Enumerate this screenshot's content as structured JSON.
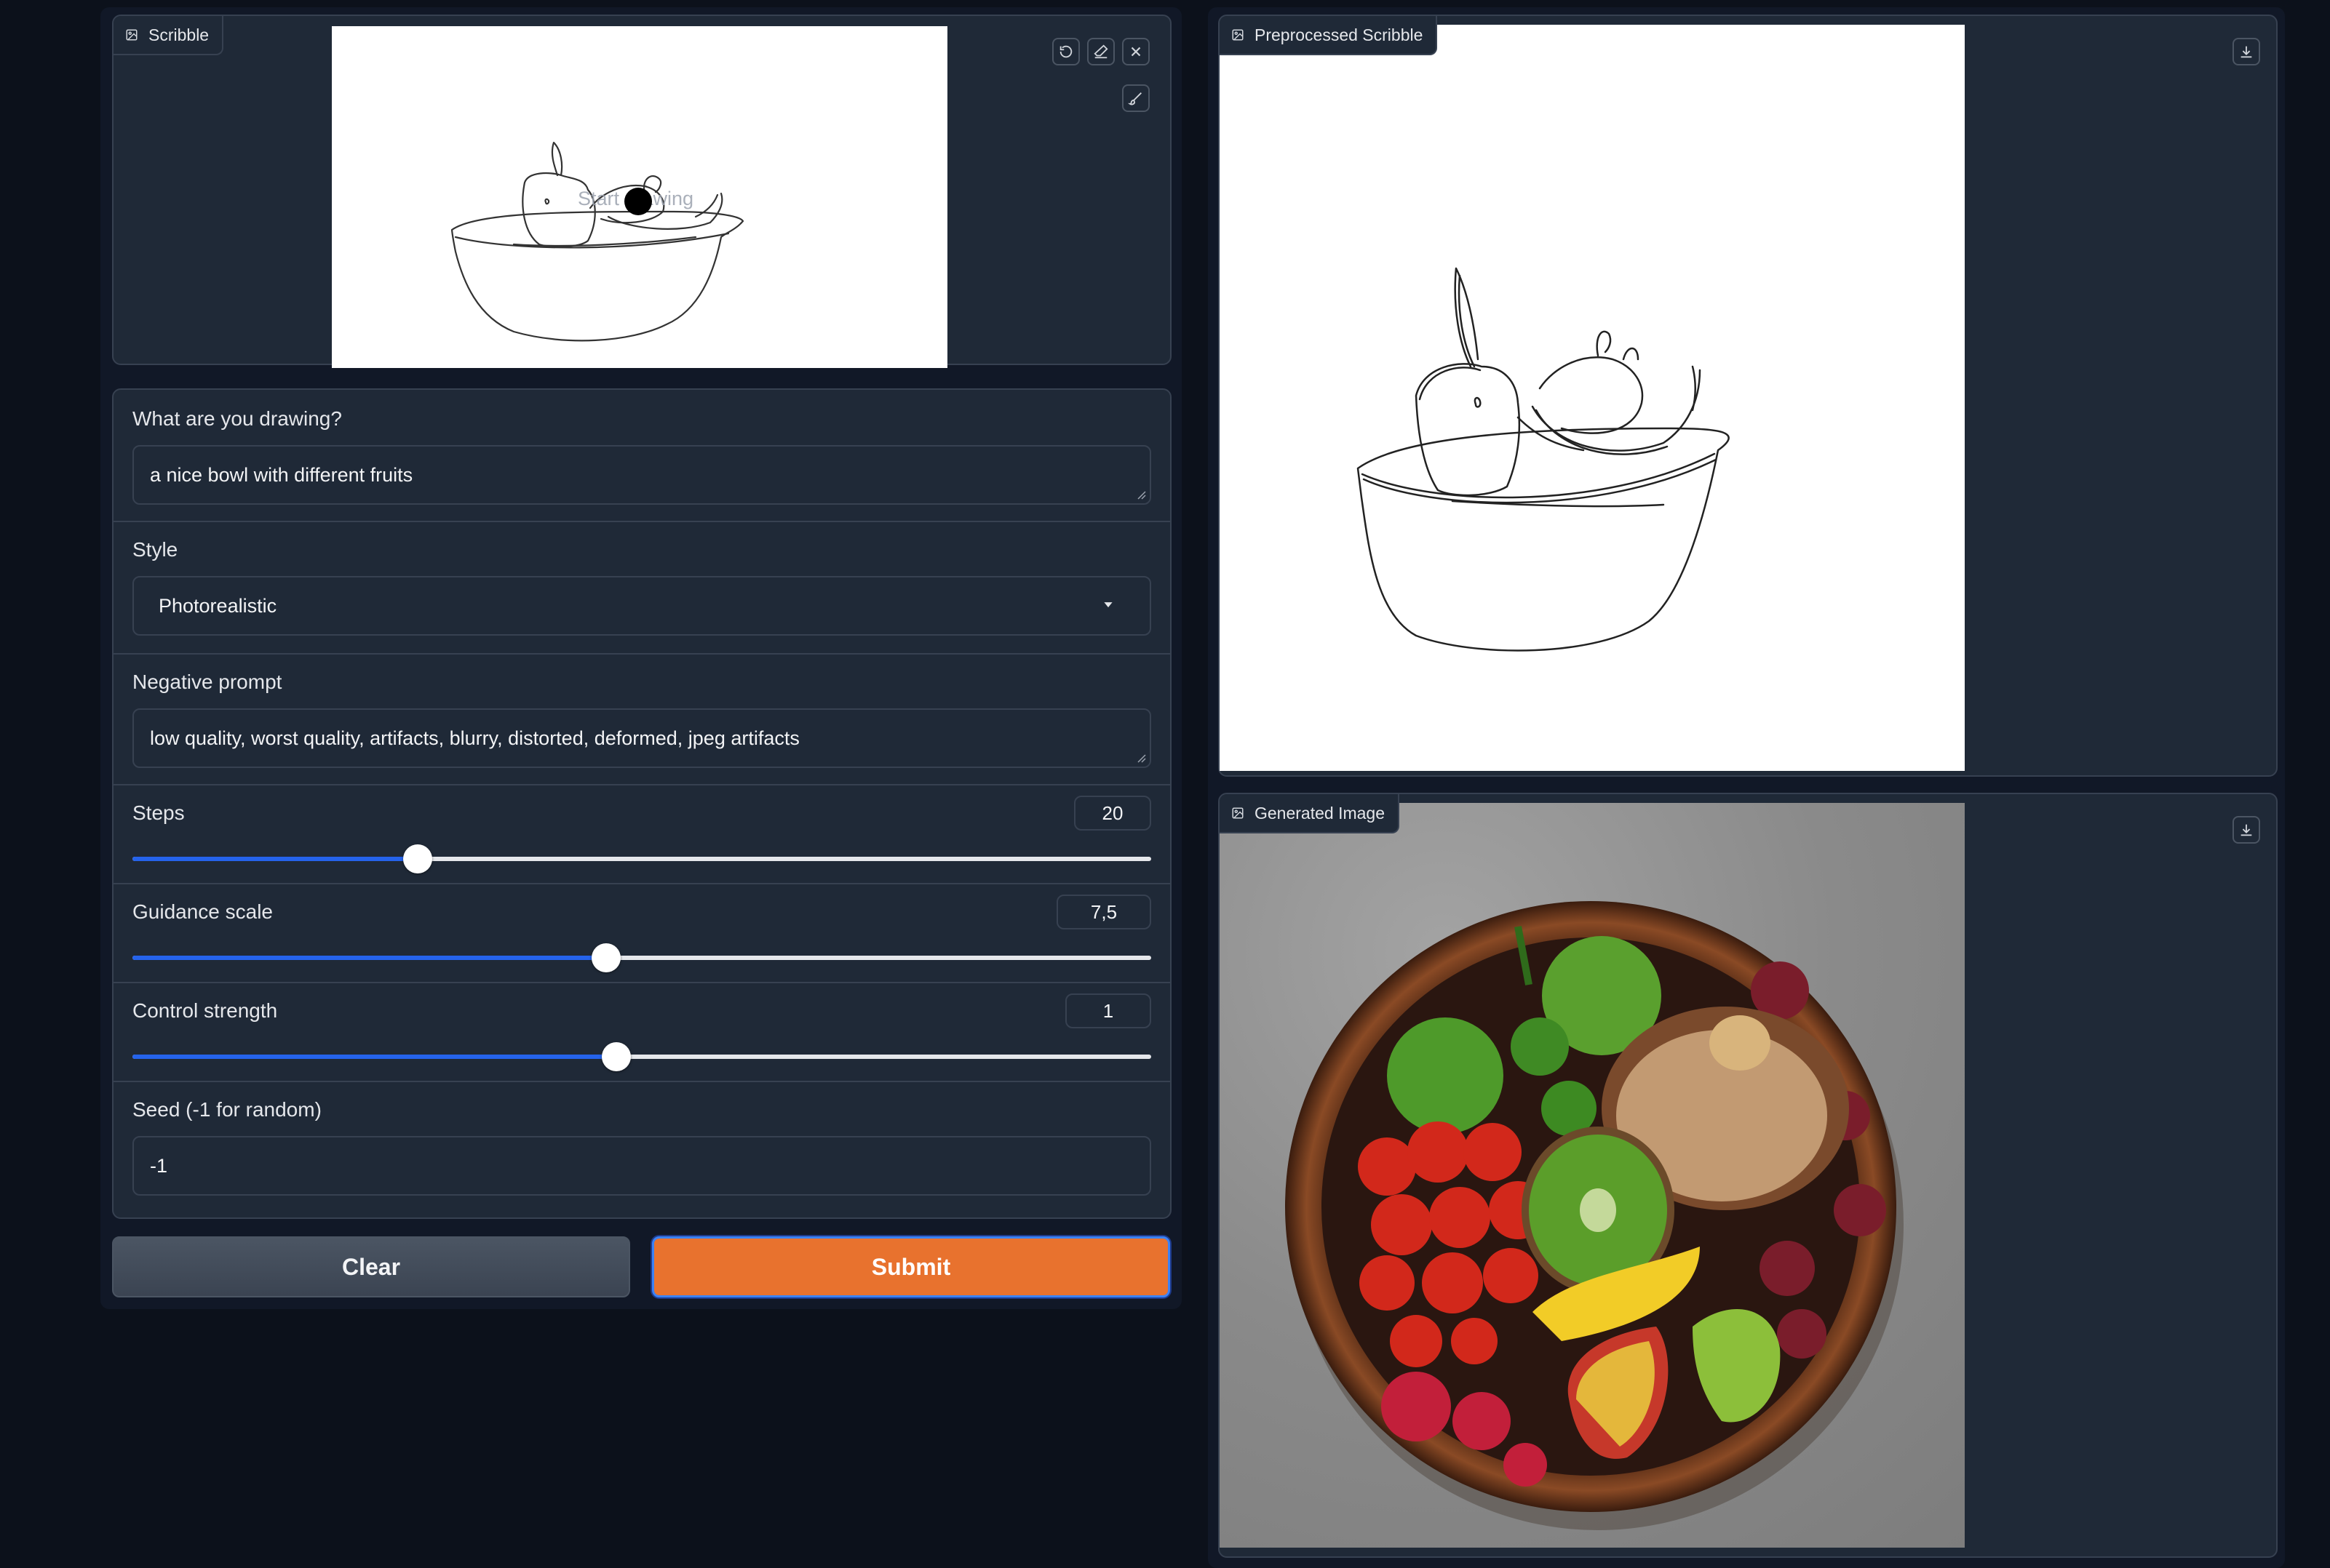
{
  "scribble": {
    "label": "Scribble",
    "placeholder": "Start drawing",
    "icons": [
      "image-icon",
      "undo-icon",
      "eraser-icon",
      "close-icon",
      "brush-icon"
    ]
  },
  "form": {
    "prompt_label": "What are you drawing?",
    "prompt_value": "a nice bowl with different fruits",
    "style_label": "Style",
    "style_value": "Photorealistic",
    "negative_label": "Negative prompt",
    "negative_value": "low quality, worst quality, artifacts, blurry, distorted, deformed, jpeg artifacts",
    "steps": {
      "label": "Steps",
      "value": "20",
      "fraction": 0.28
    },
    "guidance": {
      "label": "Guidance scale",
      "value": "7,5",
      "fraction": 0.465
    },
    "control": {
      "label": "Control strength",
      "value": "1",
      "fraction": 0.475
    },
    "seed_label": "Seed (-1 for random)",
    "seed_value": "-1"
  },
  "buttons": {
    "clear": "Clear",
    "submit": "Submit"
  },
  "preprocessed": {
    "label": "Preprocessed Scribble",
    "icons": [
      "image-icon",
      "download-icon"
    ]
  },
  "generated": {
    "label": "Generated Image",
    "icons": [
      "image-icon",
      "download-icon"
    ]
  },
  "colors": {
    "background": "#0c111b",
    "panel": "#1f2937",
    "border": "#374151",
    "slider_fill": "#2563eb",
    "submit": "#e8722e",
    "clear": "#4b5563"
  }
}
